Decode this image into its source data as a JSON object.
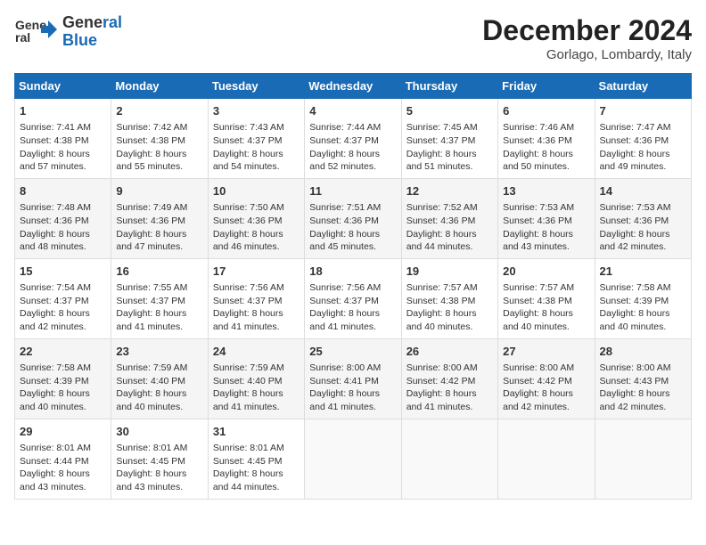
{
  "header": {
    "logo_line1": "General",
    "logo_line2": "Blue",
    "month": "December 2024",
    "location": "Gorlago, Lombardy, Italy"
  },
  "columns": [
    "Sunday",
    "Monday",
    "Tuesday",
    "Wednesday",
    "Thursday",
    "Friday",
    "Saturday"
  ],
  "weeks": [
    [
      {
        "day": "1",
        "rise": "Sunrise: 7:41 AM",
        "set": "Sunset: 4:38 PM",
        "daylight": "Daylight: 8 hours and 57 minutes."
      },
      {
        "day": "2",
        "rise": "Sunrise: 7:42 AM",
        "set": "Sunset: 4:38 PM",
        "daylight": "Daylight: 8 hours and 55 minutes."
      },
      {
        "day": "3",
        "rise": "Sunrise: 7:43 AM",
        "set": "Sunset: 4:37 PM",
        "daylight": "Daylight: 8 hours and 54 minutes."
      },
      {
        "day": "4",
        "rise": "Sunrise: 7:44 AM",
        "set": "Sunset: 4:37 PM",
        "daylight": "Daylight: 8 hours and 52 minutes."
      },
      {
        "day": "5",
        "rise": "Sunrise: 7:45 AM",
        "set": "Sunset: 4:37 PM",
        "daylight": "Daylight: 8 hours and 51 minutes."
      },
      {
        "day": "6",
        "rise": "Sunrise: 7:46 AM",
        "set": "Sunset: 4:36 PM",
        "daylight": "Daylight: 8 hours and 50 minutes."
      },
      {
        "day": "7",
        "rise": "Sunrise: 7:47 AM",
        "set": "Sunset: 4:36 PM",
        "daylight": "Daylight: 8 hours and 49 minutes."
      }
    ],
    [
      {
        "day": "8",
        "rise": "Sunrise: 7:48 AM",
        "set": "Sunset: 4:36 PM",
        "daylight": "Daylight: 8 hours and 48 minutes."
      },
      {
        "day": "9",
        "rise": "Sunrise: 7:49 AM",
        "set": "Sunset: 4:36 PM",
        "daylight": "Daylight: 8 hours and 47 minutes."
      },
      {
        "day": "10",
        "rise": "Sunrise: 7:50 AM",
        "set": "Sunset: 4:36 PM",
        "daylight": "Daylight: 8 hours and 46 minutes."
      },
      {
        "day": "11",
        "rise": "Sunrise: 7:51 AM",
        "set": "Sunset: 4:36 PM",
        "daylight": "Daylight: 8 hours and 45 minutes."
      },
      {
        "day": "12",
        "rise": "Sunrise: 7:52 AM",
        "set": "Sunset: 4:36 PM",
        "daylight": "Daylight: 8 hours and 44 minutes."
      },
      {
        "day": "13",
        "rise": "Sunrise: 7:53 AM",
        "set": "Sunset: 4:36 PM",
        "daylight": "Daylight: 8 hours and 43 minutes."
      },
      {
        "day": "14",
        "rise": "Sunrise: 7:53 AM",
        "set": "Sunset: 4:36 PM",
        "daylight": "Daylight: 8 hours and 42 minutes."
      }
    ],
    [
      {
        "day": "15",
        "rise": "Sunrise: 7:54 AM",
        "set": "Sunset: 4:37 PM",
        "daylight": "Daylight: 8 hours and 42 minutes."
      },
      {
        "day": "16",
        "rise": "Sunrise: 7:55 AM",
        "set": "Sunset: 4:37 PM",
        "daylight": "Daylight: 8 hours and 41 minutes."
      },
      {
        "day": "17",
        "rise": "Sunrise: 7:56 AM",
        "set": "Sunset: 4:37 PM",
        "daylight": "Daylight: 8 hours and 41 minutes."
      },
      {
        "day": "18",
        "rise": "Sunrise: 7:56 AM",
        "set": "Sunset: 4:37 PM",
        "daylight": "Daylight: 8 hours and 41 minutes."
      },
      {
        "day": "19",
        "rise": "Sunrise: 7:57 AM",
        "set": "Sunset: 4:38 PM",
        "daylight": "Daylight: 8 hours and 40 minutes."
      },
      {
        "day": "20",
        "rise": "Sunrise: 7:57 AM",
        "set": "Sunset: 4:38 PM",
        "daylight": "Daylight: 8 hours and 40 minutes."
      },
      {
        "day": "21",
        "rise": "Sunrise: 7:58 AM",
        "set": "Sunset: 4:39 PM",
        "daylight": "Daylight: 8 hours and 40 minutes."
      }
    ],
    [
      {
        "day": "22",
        "rise": "Sunrise: 7:58 AM",
        "set": "Sunset: 4:39 PM",
        "daylight": "Daylight: 8 hours and 40 minutes."
      },
      {
        "day": "23",
        "rise": "Sunrise: 7:59 AM",
        "set": "Sunset: 4:40 PM",
        "daylight": "Daylight: 8 hours and 40 minutes."
      },
      {
        "day": "24",
        "rise": "Sunrise: 7:59 AM",
        "set": "Sunset: 4:40 PM",
        "daylight": "Daylight: 8 hours and 41 minutes."
      },
      {
        "day": "25",
        "rise": "Sunrise: 8:00 AM",
        "set": "Sunset: 4:41 PM",
        "daylight": "Daylight: 8 hours and 41 minutes."
      },
      {
        "day": "26",
        "rise": "Sunrise: 8:00 AM",
        "set": "Sunset: 4:42 PM",
        "daylight": "Daylight: 8 hours and 41 minutes."
      },
      {
        "day": "27",
        "rise": "Sunrise: 8:00 AM",
        "set": "Sunset: 4:42 PM",
        "daylight": "Daylight: 8 hours and 42 minutes."
      },
      {
        "day": "28",
        "rise": "Sunrise: 8:00 AM",
        "set": "Sunset: 4:43 PM",
        "daylight": "Daylight: 8 hours and 42 minutes."
      }
    ],
    [
      {
        "day": "29",
        "rise": "Sunrise: 8:01 AM",
        "set": "Sunset: 4:44 PM",
        "daylight": "Daylight: 8 hours and 43 minutes."
      },
      {
        "day": "30",
        "rise": "Sunrise: 8:01 AM",
        "set": "Sunset: 4:45 PM",
        "daylight": "Daylight: 8 hours and 43 minutes."
      },
      {
        "day": "31",
        "rise": "Sunrise: 8:01 AM",
        "set": "Sunset: 4:45 PM",
        "daylight": "Daylight: 8 hours and 44 minutes."
      },
      null,
      null,
      null,
      null
    ]
  ]
}
